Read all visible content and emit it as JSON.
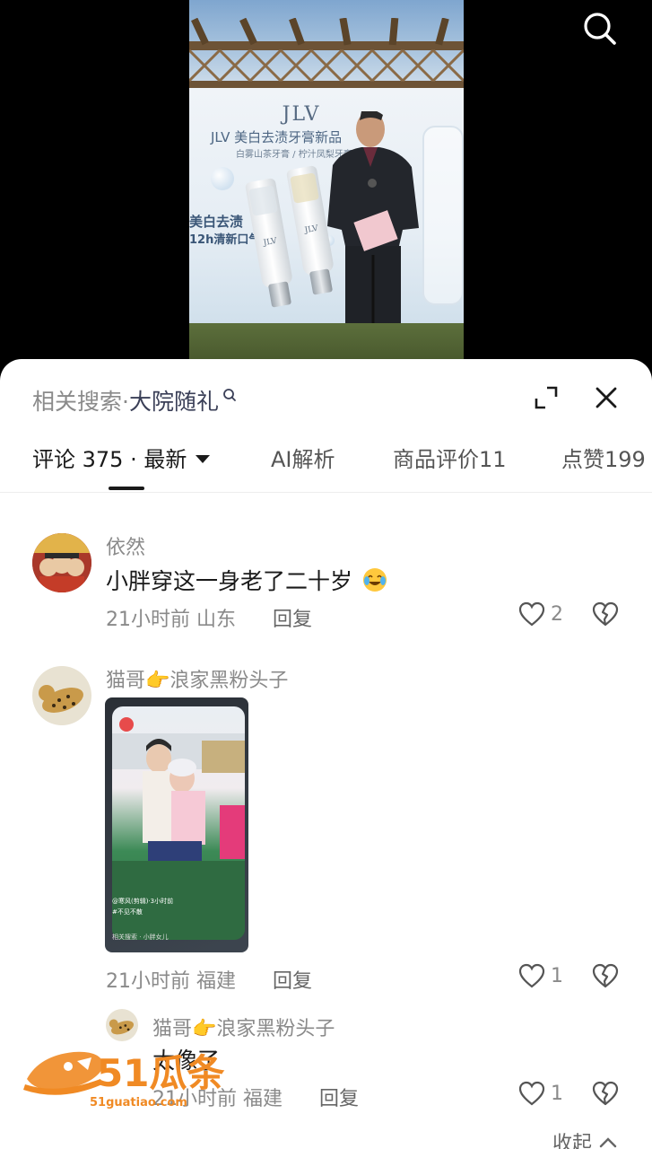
{
  "video": {
    "brand": "JLV",
    "brand_title": "JLV 美白去渍牙膏新品",
    "brand_sub": "白雾山茶牙膏 / 柠汁凤梨牙膏",
    "slogan_line1": "美白去渍",
    "slogan_line2": "12h清新口气",
    "tube_label": "JLV"
  },
  "top_search": {
    "icon": "search-icon"
  },
  "related_search": {
    "label": "相关搜索·",
    "term": "大院随礼"
  },
  "tabs": [
    {
      "label": "评论 375 · 最新",
      "active": true
    },
    {
      "label": "AI解析",
      "active": false
    },
    {
      "label": "商品评价11",
      "active": false
    },
    {
      "label": "点赞199",
      "active": false
    }
  ],
  "comments": [
    {
      "user": "依然",
      "text": "小胖穿这一身老了二十岁",
      "meta": "21小时前 山东",
      "reply": "回复",
      "likes": "2"
    },
    {
      "user": "猫哥👉浪家黑粉头子",
      "meta": "21小时前 福建",
      "reply": "回复",
      "likes": "1",
      "image_caption": "@寒风(剪辑)·3小时前",
      "image_tag": "#不见不散",
      "image_bottom": "相关搜索 · 小胖女儿"
    }
  ],
  "reply": {
    "user": "猫哥👉浪家黑粉头子",
    "text": "太像了",
    "meta": "21小时前 福建",
    "reply": "回复",
    "likes": "1"
  },
  "collapse_label": "收起",
  "watermark": {
    "text": "51瓜条",
    "url": "51guatiao.com"
  },
  "colors": {
    "accent": "#3a3f57",
    "muted": "#8a8a8a",
    "watermark": "#f08a24"
  }
}
